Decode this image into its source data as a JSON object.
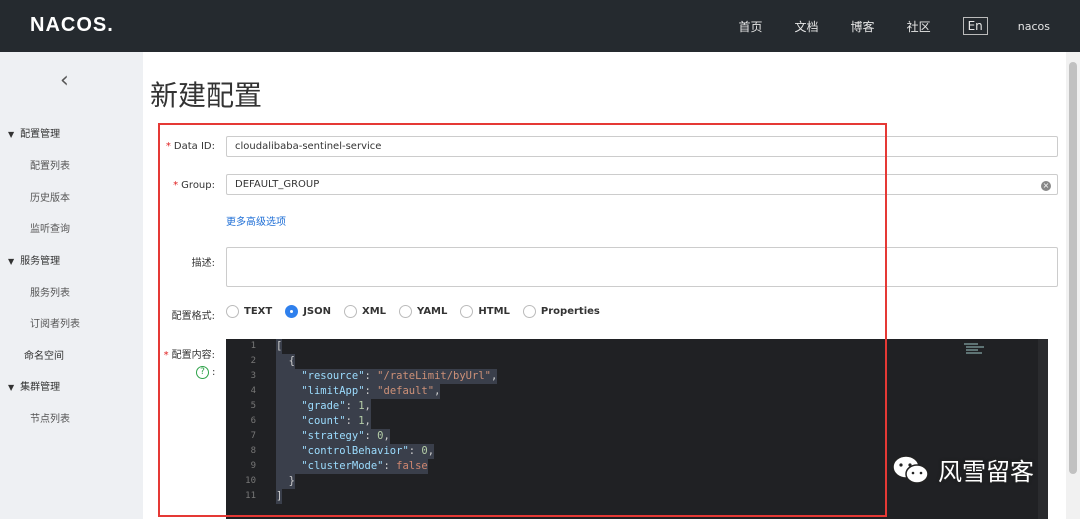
{
  "header": {
    "logo": "NACOS.",
    "nav": [
      "首页",
      "文档",
      "博客",
      "社区"
    ],
    "lang": "En",
    "user": "nacos"
  },
  "sidebar": {
    "collapse_glyph": "‹",
    "groups": [
      {
        "label": "配置管理",
        "items": [
          "配置列表",
          "历史版本",
          "监听查询"
        ]
      },
      {
        "label": "服务管理",
        "items": [
          "服务列表",
          "订阅者列表"
        ]
      },
      {
        "label": "命名空间"
      },
      {
        "label": "集群管理",
        "items": [
          "节点列表"
        ]
      }
    ]
  },
  "page": {
    "title": "新建配置"
  },
  "form": {
    "data_id_label": "Data ID:",
    "data_id_value": "cloudalibaba-sentinel-service",
    "group_label": "Group:",
    "group_value": "DEFAULT_GROUP",
    "advanced_link": "更多高级选项",
    "desc_label": "描述:",
    "desc_value": "",
    "format_label": "配置格式:",
    "formats": [
      "TEXT",
      "JSON",
      "XML",
      "YAML",
      "HTML",
      "Properties"
    ],
    "selected_format": "JSON",
    "content_label": "配置内容:",
    "help_glyph": "?",
    "help_colon": ":"
  },
  "editor": {
    "lines": [
      "[",
      "  {",
      "    \"resource\": \"/rateLimit/byUrl\",",
      "    \"limitApp\": \"default\",",
      "    \"grade\": 1,",
      "    \"count\": 1,",
      "    \"strategy\": 0,",
      "    \"controlBehavior\": 0,",
      "    \"clusterMode\": false",
      "  }",
      "]"
    ]
  },
  "watermark": {
    "text": "风雪留客"
  },
  "colors": {
    "topbar": "#252a2f",
    "accent": "#2f80ed",
    "highlight": "#e53935",
    "link": "#1f6fd6"
  }
}
